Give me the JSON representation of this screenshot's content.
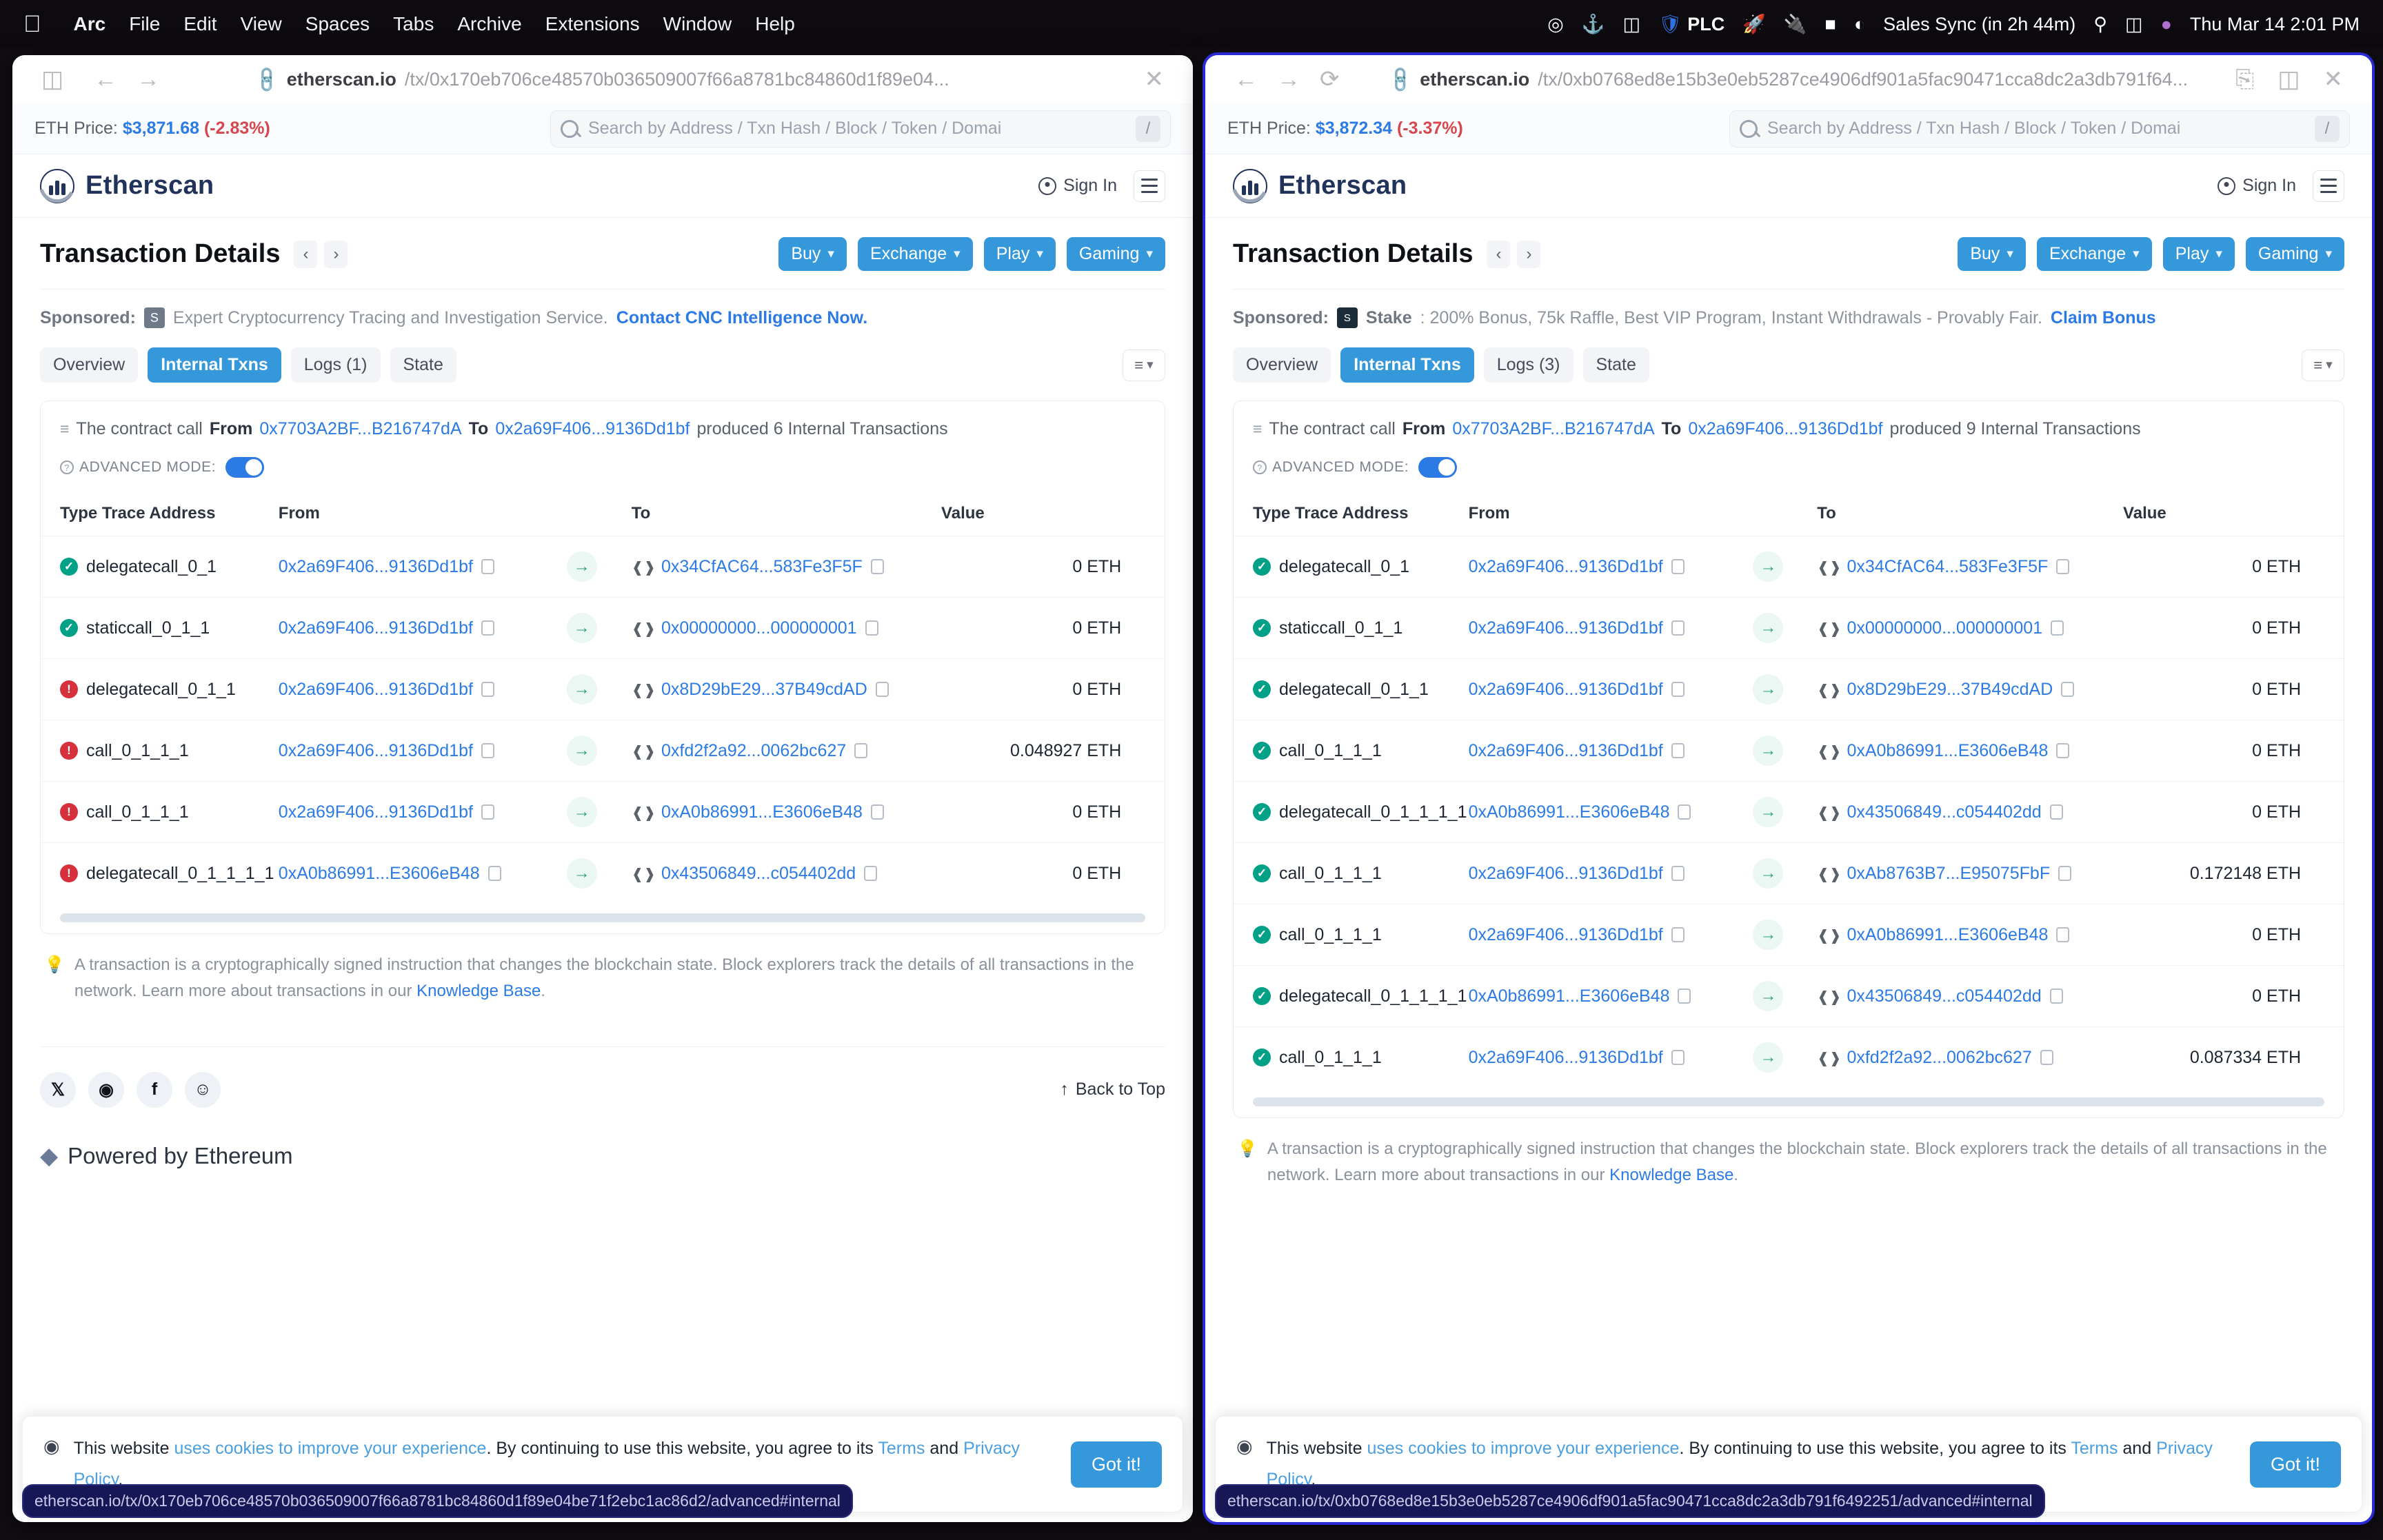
{
  "menubar": {
    "apple": "",
    "items": [
      {
        "label": "Arc",
        "bold": true
      },
      {
        "label": "File",
        "bold": false
      },
      {
        "label": "Edit",
        "bold": false
      },
      {
        "label": "View",
        "bold": false
      },
      {
        "label": "Spaces",
        "bold": false
      },
      {
        "label": "Tabs",
        "bold": false
      },
      {
        "label": "Archive",
        "bold": false
      },
      {
        "label": "Extensions",
        "bold": false
      },
      {
        "label": "Window",
        "bold": false
      },
      {
        "label": "Help",
        "bold": false
      }
    ],
    "status_icons": [
      "record-icon",
      "docker-icon",
      "grammarly-icon",
      "guardian-icon"
    ],
    "plc_label": "PLC",
    "status_text": "Sales Sync  (in 2h 44m)",
    "clock": "Thu Mar 14  2:01 PM"
  },
  "left_window": {
    "chrome": {
      "sidebar_icon": "sidebar-toggle-icon",
      "back_icon": "←",
      "forward_icon": "→",
      "link_icon": "link-icon",
      "url_domain": "etherscan.io",
      "url_path": "/tx/0x170eb706ce48570b036509007f66a8781bc84860d1f89e04...",
      "close_icon": "✕"
    },
    "topbar": {
      "eth_price_label": "ETH Price:",
      "eth_price_value": "$3,871.68",
      "eth_price_change": "(-2.83%)",
      "search_placeholder": "Search by Address / Txn Hash / Block / Token / Domai",
      "slash_key": "/"
    },
    "nav": {
      "brand": "Etherscan",
      "signin": "Sign In"
    },
    "header": {
      "title": "Transaction Details",
      "prev": "‹",
      "next": "›",
      "cta": [
        {
          "label": "Buy"
        },
        {
          "label": "Exchange"
        },
        {
          "label": "Play"
        },
        {
          "label": "Gaming"
        }
      ]
    },
    "sponsored": {
      "label": "Sponsored:",
      "text": "Expert Cryptocurrency Tracing and Investigation Service.",
      "link": "Contact CNC Intelligence Now."
    },
    "tabs": [
      {
        "label": "Overview",
        "active": false
      },
      {
        "label": "Internal Txns",
        "active": true
      },
      {
        "label": "Logs (1)",
        "active": false
      },
      {
        "label": "State",
        "active": false
      }
    ],
    "call_line": {
      "pre": "The contract call",
      "from_label": "From",
      "from_addr": "0x7703A2BF...B216747dA",
      "to_label": "To",
      "to_addr": "0x2a69F406...9136Dd1bf",
      "post": "produced 6 Internal Transactions"
    },
    "advanced_mode_label": "ADVANCED MODE:",
    "table": {
      "headers": [
        "Type Trace Address",
        "From",
        "To",
        "Value"
      ],
      "rows": [
        {
          "status": "ok",
          "type": "delegatecall_0_1",
          "from": "0x2a69F406...9136Dd1bf",
          "to": "0x34CfAC64...583Fe3F5F",
          "value": "0 ETH"
        },
        {
          "status": "ok",
          "type": "staticcall_0_1_1",
          "from": "0x2a69F406...9136Dd1bf",
          "to": "0x00000000...000000001",
          "value": "0 ETH"
        },
        {
          "status": "err",
          "type": "delegatecall_0_1_1",
          "from": "0x2a69F406...9136Dd1bf",
          "to": "0x8D29bE29...37B49cdAD",
          "value": "0 ETH"
        },
        {
          "status": "err",
          "type": "call_0_1_1_1",
          "from": "0x2a69F406...9136Dd1bf",
          "to": "0xfd2f2a92...0062bc627",
          "value": "0.048927 ETH"
        },
        {
          "status": "err",
          "type": "call_0_1_1_1",
          "from": "0x2a69F406...9136Dd1bf",
          "to": "0xA0b86991...E3606eB48",
          "value": "0 ETH"
        },
        {
          "status": "err",
          "type": "delegatecall_0_1_1_1_1",
          "from": "0xA0b86991...E3606eB48",
          "to": "0x43506849...c054402dd",
          "value": "0 ETH"
        }
      ]
    },
    "note": {
      "text": "A transaction is a cryptographically signed instruction that changes the blockchain state. Block explorers track the details of all transactions in the network. Learn more about transactions in our ",
      "link": "Knowledge Base",
      "period": "."
    },
    "footer": {
      "socials": [
        "x-icon",
        "medium-icon",
        "facebook-icon",
        "reddit-icon"
      ],
      "back_to_top": "Back to Top",
      "powered_by": "Powered by Ethereum"
    },
    "cookie": {
      "pre": "This website ",
      "link1": "uses cookies to improve your experience",
      "mid": ". By continuing to use this website, you agree to its ",
      "link2": "Terms",
      "and": " and ",
      "link3": "Privacy Policy",
      "end": ".",
      "button": "Got it!"
    },
    "status_url": "etherscan.io/tx/0x170eb706ce48570b036509007f66a8781bc84860d1f89e04be71f2ebc1ac86d2/advanced#internal"
  },
  "right_window": {
    "chrome": {
      "back_icon": "←",
      "forward_icon": "→",
      "reload_icon": "⟳",
      "link_icon": "link-icon",
      "url_domain": "etherscan.io",
      "url_path": "/tx/0xb0768ed8e15b3e0eb5287ce4906df901a5fac90471cca8dc2a3db791f64...",
      "copy_icon": "duplicate-icon",
      "split_icon": "split-view-icon",
      "close_icon": "✕"
    },
    "topbar": {
      "eth_price_label": "ETH Price:",
      "eth_price_value": "$3,872.34",
      "eth_price_change": "(-3.37%)",
      "search_placeholder": "Search by Address / Txn Hash / Block / Token / Domai",
      "slash_key": "/"
    },
    "nav": {
      "brand": "Etherscan",
      "signin": "Sign In"
    },
    "header": {
      "title": "Transaction Details",
      "prev": "‹",
      "next": "›",
      "cta": [
        {
          "label": "Buy"
        },
        {
          "label": "Exchange"
        },
        {
          "label": "Play"
        },
        {
          "label": "Gaming"
        }
      ]
    },
    "sponsored": {
      "label": "Sponsored:",
      "brand": "Stake",
      "text": ": 200% Bonus, 75k Raffle, Best VIP Program, Instant Withdrawals - Provably Fair.",
      "link": "Claim Bonus"
    },
    "tabs": [
      {
        "label": "Overview",
        "active": false
      },
      {
        "label": "Internal Txns",
        "active": true
      },
      {
        "label": "Logs (3)",
        "active": false
      },
      {
        "label": "State",
        "active": false
      }
    ],
    "call_line": {
      "pre": "The contract call",
      "from_label": "From",
      "from_addr": "0x7703A2BF...B216747dA",
      "to_label": "To",
      "to_addr": "0x2a69F406...9136Dd1bf",
      "post": "produced 9 Internal Transactions"
    },
    "advanced_mode_label": "ADVANCED MODE:",
    "table": {
      "headers": [
        "Type Trace Address",
        "From",
        "To",
        "Value"
      ],
      "rows": [
        {
          "status": "ok",
          "type": "delegatecall_0_1",
          "from": "0x2a69F406...9136Dd1bf",
          "to": "0x34CfAC64...583Fe3F5F",
          "value": "0 ETH"
        },
        {
          "status": "ok",
          "type": "staticcall_0_1_1",
          "from": "0x2a69F406...9136Dd1bf",
          "to": "0x00000000...000000001",
          "value": "0 ETH"
        },
        {
          "status": "ok",
          "type": "delegatecall_0_1_1",
          "from": "0x2a69F406...9136Dd1bf",
          "to": "0x8D29bE29...37B49cdAD",
          "value": "0 ETH"
        },
        {
          "status": "ok",
          "type": "call_0_1_1_1",
          "from": "0x2a69F406...9136Dd1bf",
          "to": "0xA0b86991...E3606eB48",
          "value": "0 ETH"
        },
        {
          "status": "ok",
          "type": "delegatecall_0_1_1_1_1",
          "from": "0xA0b86991...E3606eB48",
          "to": "0x43506849...c054402dd",
          "value": "0 ETH"
        },
        {
          "status": "ok",
          "type": "call_0_1_1_1",
          "from": "0x2a69F406...9136Dd1bf",
          "to": "0xAb8763B7...E95075FbF",
          "value": "0.172148 ETH"
        },
        {
          "status": "ok",
          "type": "call_0_1_1_1",
          "from": "0x2a69F406...9136Dd1bf",
          "to": "0xA0b86991...E3606eB48",
          "value": "0 ETH"
        },
        {
          "status": "ok",
          "type": "delegatecall_0_1_1_1_1",
          "from": "0xA0b86991...E3606eB48",
          "to": "0x43506849...c054402dd",
          "value": "0 ETH"
        },
        {
          "status": "ok",
          "type": "call_0_1_1_1",
          "from": "0x2a69F406...9136Dd1bf",
          "to": "0xfd2f2a92...0062bc627",
          "value": "0.087334 ETH"
        }
      ]
    },
    "note": {
      "text": "A transaction is a cryptographically signed instruction that changes the blockchain state. Block explorers track the details of all transactions in the network. Learn more about transactions in our ",
      "link": "Knowledge Base",
      "period": "."
    },
    "cookie": {
      "pre": "This website ",
      "link1": "uses cookies to improve your experience",
      "mid": ". By continuing to use this website, you agree to its ",
      "link2": "Terms",
      "and": " and ",
      "link3": "Privacy Policy",
      "end": ".",
      "button": "Got it!"
    },
    "status_url": "etherscan.io/tx/0xb0768ed8e15b3e0eb5287ce4906df901a5fac90471cca8dc2a3db791f6492251/advanced#internal"
  }
}
